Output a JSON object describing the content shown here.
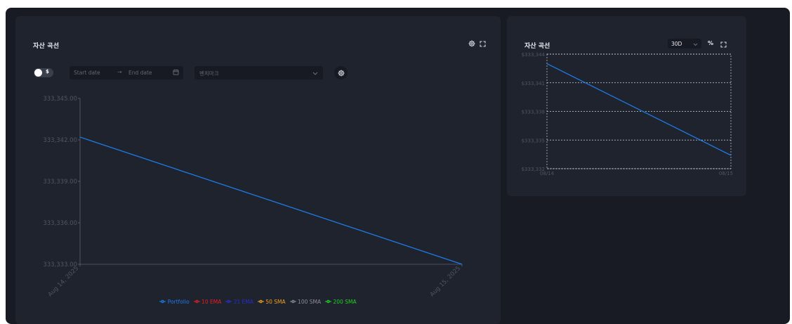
{
  "main_card": {
    "title": "자산 곡선",
    "toggle_label": "$",
    "date_start_placeholder": "Start date",
    "date_end_placeholder": "End date",
    "date_arrow": "→",
    "benchmark_placeholder": "벤치마크",
    "icons": [
      "gear-icon",
      "fullscreen-icon",
      "calendar-icon",
      "chevron-down-icon",
      "gear-icon"
    ]
  },
  "side_card": {
    "title": "자산 곡선",
    "period_value": "30D",
    "percent_label": "%",
    "icons": [
      "chevron-down-icon",
      "fullscreen-icon"
    ]
  },
  "legend": {
    "items": [
      {
        "label": "Portfolio",
        "color": "#1e7be6"
      },
      {
        "label": "10 EMA",
        "color": "#e02020"
      },
      {
        "label": "21 EMA",
        "color": "#2430c8"
      },
      {
        "label": "50 SMA",
        "color": "#f0a020"
      },
      {
        "label": "100 SMA",
        "color": "#8c8c96"
      },
      {
        "label": "200 SMA",
        "color": "#22d022"
      }
    ]
  },
  "chart_data": [
    {
      "type": "line",
      "x": [
        "Aug 14, 2025",
        "Aug 15, 2025"
      ],
      "series": [
        {
          "name": "Portfolio",
          "values": [
            333342.2,
            333333.0
          ]
        }
      ],
      "yticks": [
        "333,345.00",
        "333,342.00",
        "333,339.00",
        "333,336.00",
        "333,333.00"
      ],
      "ylim": [
        333333.0,
        333345.0
      ],
      "grid": false,
      "legend": "bottom",
      "line_color": "#1e7be6"
    },
    {
      "type": "line",
      "x": [
        "08/14",
        "08/15"
      ],
      "series": [
        {
          "values": [
            333343.0,
            333333.4
          ]
        }
      ],
      "yticks": [
        "$333,344",
        "$333,341",
        "$333,338",
        "$333,335",
        "$333,332"
      ],
      "ylim": [
        333332.0,
        333344.0
      ],
      "grid": true,
      "line_color": "#1e7be6"
    }
  ]
}
